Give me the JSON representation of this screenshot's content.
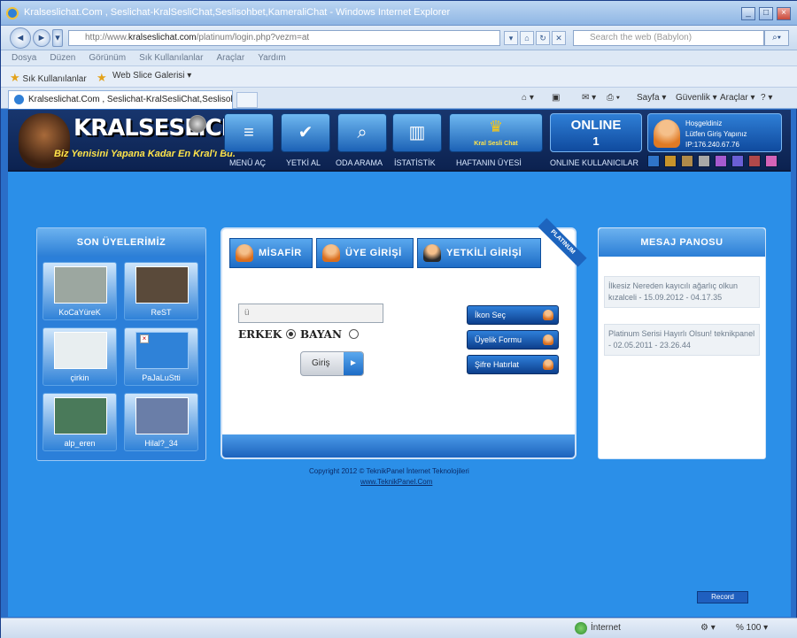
{
  "window": {
    "title": "Kralseslichat.Com , Seslichat-KralSesliChat,Seslisohbet,KameraliChat - Windows Internet Explorer"
  },
  "addressbar": {
    "url_prefix": "http://www.",
    "url_domain": "kralseslichat.com",
    "url_path": "/platinum/login.php?vezm=at",
    "search_placeholder": "Search the web (Babylon)",
    "search_btn_icon": "magnifier-icon"
  },
  "menubar": {
    "items": [
      "Dosya",
      "Düzen",
      "Görünüm",
      "Sık Kullanılanlar",
      "Araçlar",
      "Yardım"
    ]
  },
  "favbar": {
    "favorites_label": "Sık Kullanılanlar",
    "web_slice_label": "Web Slice Galerisi ▾"
  },
  "tabbar": {
    "tab_title": "Kralseslichat.Com , Seslichat-KralSesliChat,Seslisohbe...",
    "commands": [
      "Sayfa ▾",
      "Güvenlik ▾",
      "Araçlar ▾"
    ]
  },
  "header": {
    "logo_text": "KRALSESLiCHAT",
    "slogan": "Biz Yenisini Yapana Kadar En Kral'ı Bu.",
    "nav": [
      {
        "label": "MENÜ AÇ",
        "icon": "menu-icon"
      },
      {
        "label": "YETKİ AL",
        "icon": "user-check-icon"
      },
      {
        "label": "ODA ARAMA",
        "icon": "search-room-icon"
      },
      {
        "label": "İSTATİSTİK",
        "icon": "chart-icon"
      },
      {
        "label": "HAFTANIN ÜYESİ",
        "icon": "crown-icon"
      },
      {
        "label": "ONLINE KULLANICILAR",
        "icon": "users-icon"
      }
    ],
    "king_badge": "Kral Sesli Chat",
    "online_label": "ONLINE",
    "online_count": "1",
    "user_line1": "Hoşgeldiniz",
    "user_line2": "Lütfen Giriş Yapınız",
    "user_line3": "IP:176.240.67.76",
    "swatches": [
      "#2f74c8",
      "#c8932b",
      "#b08a4a",
      "#a8a8a8",
      "#a65ad0",
      "#6a5fd6",
      "#b0484a",
      "#d463b8"
    ]
  },
  "members": {
    "title": "SON ÜYELERİMİZ",
    "items": [
      {
        "name": "KoCaYüreK"
      },
      {
        "name": "ReST"
      },
      {
        "name": "çirkin"
      },
      {
        "name": "PaJaLuStti"
      },
      {
        "name": "alp_eren"
      },
      {
        "name": "Hilal?_34"
      }
    ]
  },
  "login": {
    "tabs": [
      "MİSAFİR",
      "ÜYE GİRİŞİ",
      "YETKİLİ GİRİŞİ"
    ],
    "ribbon": "PLATINUM",
    "username_value": "ü",
    "gender_male": "ERKEK",
    "gender_female": "BAYAN",
    "submit": "Giriş",
    "actions": [
      "İkon Seç",
      "Üyelik Formu",
      "Şifre Hatırlat"
    ]
  },
  "board": {
    "title": "MESAJ PANOSU",
    "messages": [
      "İlkesiz Nereden kayıcılı ağarlıç olkun kızalceli - 15.09.2012 - 04.17.35",
      "Platinum Serisi Hayırlı Olsun! teknikpanel - 02.05.2011 - 23.26.44"
    ]
  },
  "footer": {
    "copyright": "Copyright 2012 © TeknikPanel İnternet Teknolojileri",
    "link": "www.TeknikPanel.Com"
  },
  "record_button": "Record",
  "statusbar": {
    "zone": "İnternet",
    "zoom": "% 100 ▾"
  }
}
